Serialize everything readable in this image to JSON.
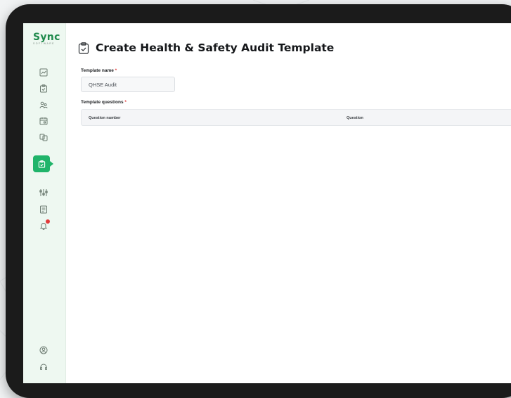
{
  "brand": {
    "name": "Sync",
    "tagline": "SOFTWARE"
  },
  "page": {
    "title": "Create Health & Safety Audit Template"
  },
  "form": {
    "template_name_label": "Template name",
    "template_name_value": "QHSE Audit",
    "template_questions_label": "Template questions",
    "required_mark": "*"
  },
  "table": {
    "columns": [
      "Question number",
      "Question"
    ]
  },
  "sidebar": {
    "icons": [
      "chart-icon",
      "clipboard-icon",
      "people-icon",
      "calendar-icon",
      "folder-copy-icon",
      "audit-template-icon",
      "adjustments-icon",
      "report-icon",
      "notification-bell-icon",
      "user-icon",
      "headset-icon"
    ]
  },
  "colors": {
    "accent": "#20b46a",
    "sidebar_bg": "#eef8f1",
    "badge": "#e23b3b"
  }
}
